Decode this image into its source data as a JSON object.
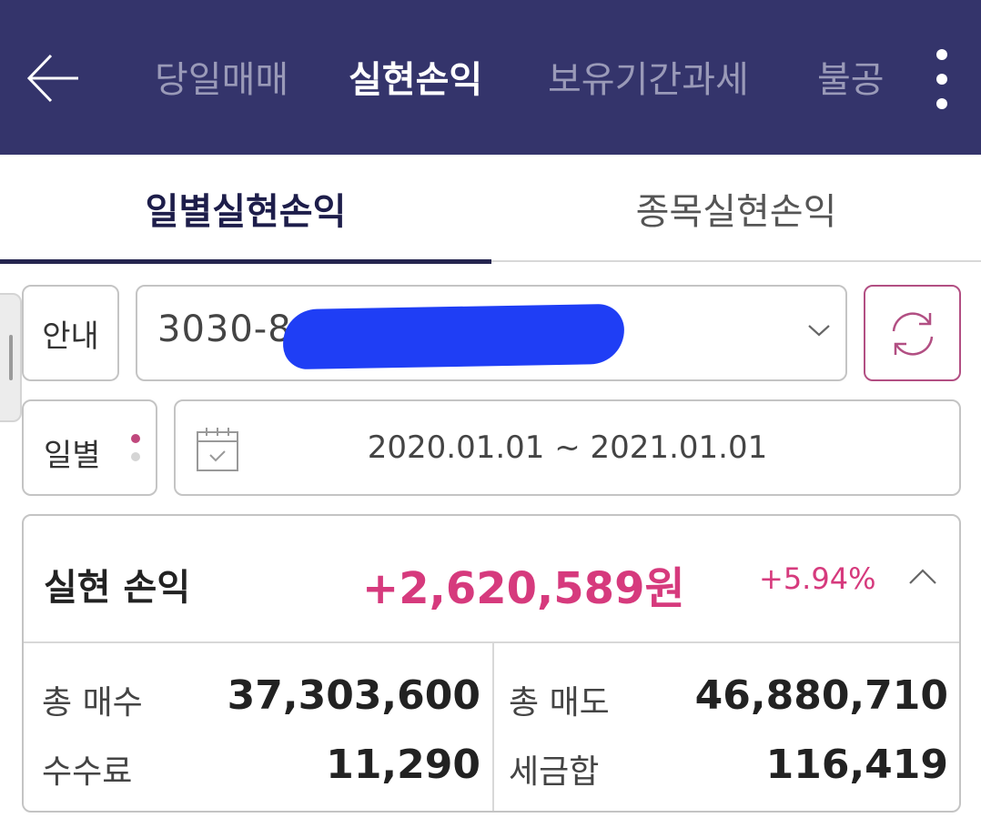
{
  "header": {
    "tabs": [
      {
        "label": "당일매매",
        "active": false
      },
      {
        "label": "실현손익",
        "active": true
      },
      {
        "label": "보유기간과세",
        "active": false
      },
      {
        "label": "불공",
        "active": false
      }
    ],
    "back_icon": "arrow-left-icon",
    "more_icon": "more-vertical-icon"
  },
  "subtabs": [
    {
      "label": "일별실현손익",
      "active": true
    },
    {
      "label": "종목실현손익",
      "active": false
    }
  ],
  "filters": {
    "info_button": "안내",
    "account_number": "3030-8",
    "period_type": "일별",
    "date_range": "2020.01.01 ~ 2021.01.01",
    "refresh_icon": "refresh-icon",
    "calendar_icon": "calendar-icon",
    "dropdown_icon": "chevron-down-icon"
  },
  "summary": {
    "title": "실현 손익",
    "amount": "+2,620,589원",
    "percent": "+5.94%",
    "collapse_icon": "chevron-up-icon",
    "rows": [
      {
        "left_label": "총 매수",
        "left_value": "37,303,600",
        "right_label": "총 매도",
        "right_value": "46,880,710"
      },
      {
        "left_label": "수수료",
        "left_value": "11,290",
        "right_label": "세금합",
        "right_value": "116,419"
      }
    ]
  },
  "colors": {
    "header_bg": "#34346b",
    "accent_pink": "#d63a7d",
    "refresh_border": "#b24f83"
  }
}
